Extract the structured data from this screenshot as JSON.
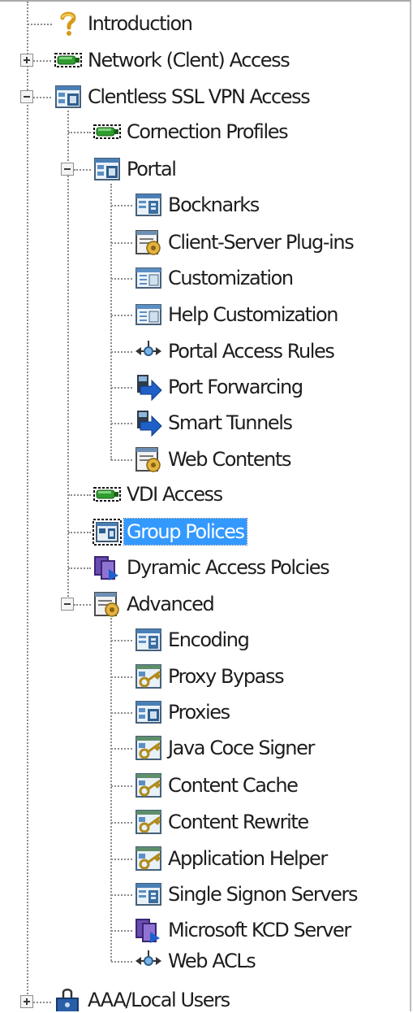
{
  "tree": {
    "introduction": {
      "label": "Introduction",
      "icon": "help-icon"
    },
    "network_client_access": {
      "label": "Network (Clent) Access",
      "icon": "adapter-icon",
      "expanded": false
    },
    "clientless_ssl_vpn_access": {
      "label": "Clentless SSL VPN Access",
      "icon": "config-panel-icon",
      "expanded": true,
      "connection_profiles": {
        "label": "Cornection Profiles",
        "icon": "adapter-icon"
      },
      "portal": {
        "label": "Portal",
        "icon": "config-panel-icon",
        "expanded": true,
        "bookmarks": {
          "label": "Bocknarks",
          "icon": "bookmark-panel-icon"
        },
        "client_server_plugins": {
          "label": "Client-Server Plug-ins",
          "icon": "plugin-icon"
        },
        "customization": {
          "label": "Customization",
          "icon": "window-icon"
        },
        "help_customization": {
          "label": "Help Customization",
          "icon": "window-icon"
        },
        "portal_access_rules": {
          "label": "Portal Access Rules",
          "icon": "rule-arrows-icon"
        },
        "port_forwarding": {
          "label": "Port Forwarcing",
          "icon": "forward-arrow-icon"
        },
        "smart_tunnels": {
          "label": "Smart Tunnels",
          "icon": "forward-arrow-icon"
        },
        "web_contents": {
          "label": "Web Contents",
          "icon": "plugin-icon"
        }
      },
      "vdi_access": {
        "label": "VDI Access",
        "icon": "adapter-icon"
      },
      "group_policies": {
        "label": "Group Polices",
        "icon": "group-policy-icon",
        "selected": true
      },
      "dynamic_access_policies": {
        "label": "Dyramic Access Polcies",
        "icon": "dynamic-policy-icon"
      },
      "advanced": {
        "label": "Advanced",
        "icon": "plugin-icon",
        "expanded": true,
        "encoding": {
          "label": "Encoding",
          "icon": "bookmark-panel-icon"
        },
        "proxy_bypass": {
          "label": "Proxy Bypass",
          "icon": "key-panel-icon"
        },
        "proxies": {
          "label": "Proxies",
          "icon": "config-panel-icon"
        },
        "java_code_signer": {
          "label": "Java Coce Signer",
          "icon": "key-panel-icon"
        },
        "content_cache": {
          "label": "Content Cache",
          "icon": "key-panel-icon"
        },
        "content_rewrite": {
          "label": "Content Rewrite",
          "icon": "key-panel-icon"
        },
        "application_helper": {
          "label": "Application Helper",
          "icon": "key-panel-icon"
        },
        "single_signon_servers": {
          "label": "Single Signon Servers",
          "icon": "bookmark-panel-icon"
        },
        "microsoft_kcd_server": {
          "label": "Microsoft KCD Server",
          "icon": "dynamic-policy-icon"
        },
        "web_acls": {
          "label": "Web ACLs",
          "icon": "rule-arrows-icon"
        }
      }
    },
    "aaa_local_users": {
      "label": "AAA/Local Users",
      "icon": "user-lock-icon",
      "expanded": false
    }
  },
  "colors": {
    "selection": "#3399ff",
    "text": "#1d1d1d",
    "tree_lines": "#8c8c8c"
  }
}
